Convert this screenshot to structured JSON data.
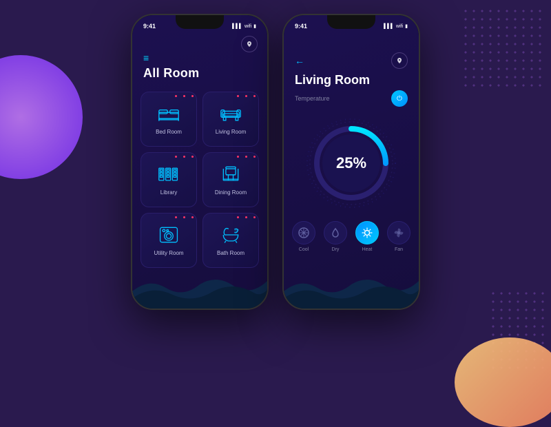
{
  "background": {
    "color": "#2a1a4e"
  },
  "phone1": {
    "title": "All Room",
    "status_time": "9:41",
    "nav_icon": "📍",
    "rooms": [
      {
        "id": "bedroom",
        "label": "Bed Room",
        "icon": "bed"
      },
      {
        "id": "livingroom",
        "label": "Living Room",
        "icon": "sofa"
      },
      {
        "id": "library",
        "label": "Library",
        "icon": "library"
      },
      {
        "id": "diningroom",
        "label": "Dining Room",
        "icon": "dining"
      },
      {
        "id": "utilityroom",
        "label": "Utility Room",
        "icon": "washer"
      },
      {
        "id": "bathroom",
        "label": "Bath Room",
        "icon": "bath"
      }
    ]
  },
  "phone2": {
    "title": "Living Room",
    "status_time": "9:41",
    "back_label": "←",
    "temp_label": "Temperature",
    "gauge_value": "25%",
    "controls": [
      {
        "id": "cool",
        "label": "Cool",
        "icon": "gear",
        "active": false
      },
      {
        "id": "dry",
        "label": "Dry",
        "icon": "drop",
        "active": false
      },
      {
        "id": "heat",
        "label": "Heat",
        "icon": "sun",
        "active": true
      },
      {
        "id": "fan",
        "label": "Fan",
        "icon": "fan",
        "active": false
      }
    ]
  }
}
